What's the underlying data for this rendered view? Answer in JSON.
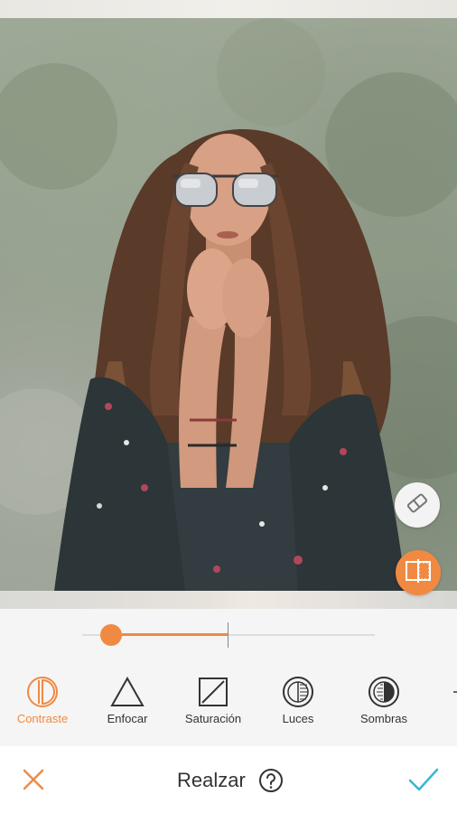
{
  "app": {
    "mode_title": "Realzar",
    "accent_color": "#f08a43",
    "confirm_color": "#38b5d6"
  },
  "photo": {
    "subject": "woman with long wavy hair wearing mirrored sunglasses, floral kimono, outdoor greenery background"
  },
  "overlay_buttons": {
    "eraser_icon": "eraser-icon",
    "compare_icon": "split-compare-icon"
  },
  "slider": {
    "value_fraction": 0.1,
    "center_fraction": 0.5
  },
  "tools": [
    {
      "label": "Contraste",
      "icon": "contrast-icon",
      "active": true
    },
    {
      "label": "Enfocar",
      "icon": "triangle-sharpen-icon",
      "active": false
    },
    {
      "label": "Saturación",
      "icon": "saturation-icon",
      "active": false
    },
    {
      "label": "Luces",
      "icon": "highlights-icon",
      "active": false
    },
    {
      "label": "Sombras",
      "icon": "shadows-icon",
      "active": false
    }
  ],
  "bottom_bar": {
    "close_icon": "close-icon",
    "help_icon": "help-icon",
    "confirm_icon": "check-icon"
  }
}
